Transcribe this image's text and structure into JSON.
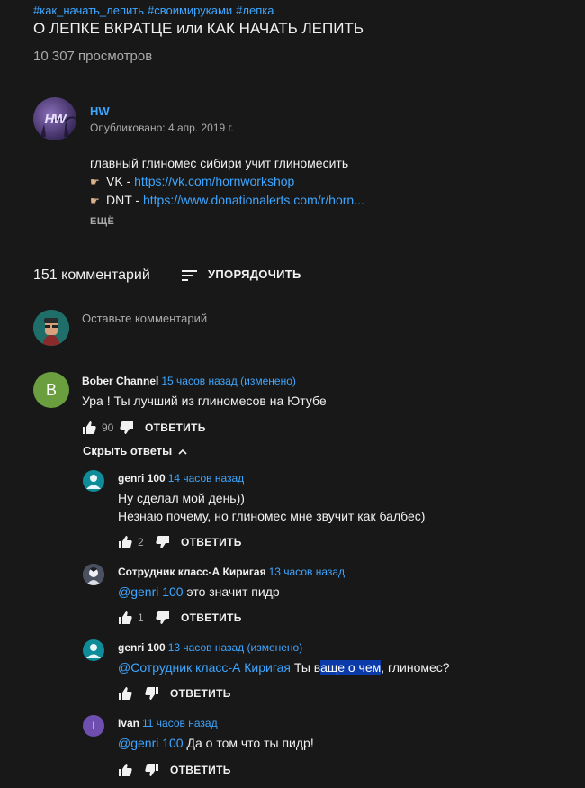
{
  "video": {
    "hashtags": [
      "#как_начать_лепить",
      "#своимируками",
      "#лепка"
    ],
    "title": "О ЛЕПКЕ ВКРАТЦЕ или КАК НАЧАТЬ ЛЕПИТЬ",
    "views": "10 307 просмотров"
  },
  "channel": {
    "avatar_text": "HW",
    "name": "HW",
    "published": "Опубликовано: 4 апр. 2019 г."
  },
  "description": {
    "line1": "главный глиномес сибири учит глиномесить",
    "vk_label": "VK - ",
    "vk_link": "https://vk.com/hornworkshop",
    "dnt_label": "DNT - ",
    "dnt_link": "https://www.donationalerts.com/r/horn...",
    "more": "ЕЩЁ"
  },
  "comments_header": {
    "count": "151 комментарий",
    "sort_label": "УПОРЯДОЧИТЬ",
    "input_placeholder": "Оставьте комментарий"
  },
  "top_comment": {
    "avatar_letter": "B",
    "author": "Bober Channel",
    "time": "15 часов назад (изменено)",
    "text": "Ура ! Ты лучший из глиномесов на Ютубе",
    "likes": "90",
    "reply_label": "ОТВЕТИТЬ",
    "hide_replies": "Скрыть ответы"
  },
  "replies": [
    {
      "author": "genri 100",
      "time": "14 часов назад",
      "line1": "Ну сделал мой день))",
      "line2": "Незнаю почему, но глиномес мне звучит как балбес)",
      "likes": "2",
      "reply_label": "ОТВЕТИТЬ"
    },
    {
      "author": "Сотрудник класс-А Киригая",
      "time": "13 часов назад",
      "mention": "@genri 100",
      "text": " это значит пидр",
      "likes": "1",
      "reply_label": "ОТВЕТИТЬ"
    },
    {
      "author": "genri 100",
      "time": "13 часов назад (изменено)",
      "mention": "@Сотрудник класс-А Киригая",
      "text_pre": " Ты в",
      "text_sel": "аще о чем",
      "text_post": ", глиномес?",
      "likes": "",
      "reply_label": "ОТВЕТИТЬ"
    },
    {
      "avatar_letter": "I",
      "author": "Ivan",
      "time": "11 часов назад",
      "mention": "@genri 100",
      "text": " Да о том что ты пидр!",
      "likes": "",
      "reply_label": "ОТВЕТИТЬ"
    }
  ],
  "colors": {
    "background": "#181818",
    "link": "#3ea6ff",
    "muted": "#aaaaaa",
    "bober_avatar": "#6a9e3f",
    "genri_avatar": "#0e8c9a",
    "ivan_avatar": "#6e4fb0",
    "selection": "#0a3ba8"
  }
}
